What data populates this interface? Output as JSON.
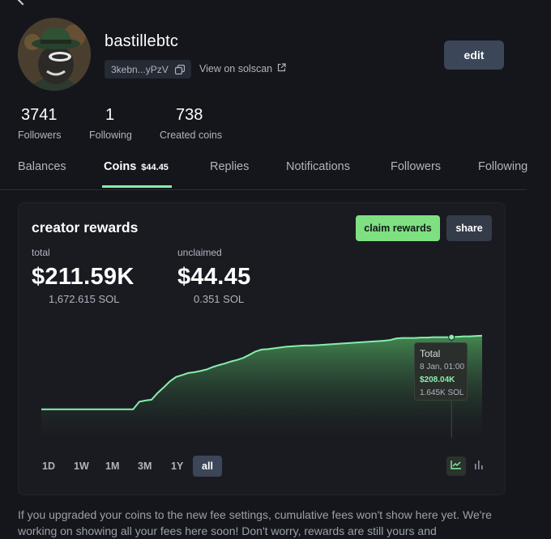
{
  "profile": {
    "username": "bastillebtc",
    "address_short": "3kebn...yPzV",
    "view_on_solscan": "View on solscan",
    "edit_label": "edit"
  },
  "stats": [
    {
      "value": "3741",
      "label": "Followers"
    },
    {
      "value": "1",
      "label": "Following"
    },
    {
      "value": "738",
      "label": "Created coins"
    }
  ],
  "tabs": [
    {
      "label": "Balances"
    },
    {
      "label": "Coins",
      "badge": "$44.45",
      "active": true
    },
    {
      "label": "Replies"
    },
    {
      "label": "Notifications"
    },
    {
      "label": "Followers"
    },
    {
      "label": "Following"
    }
  ],
  "rewards": {
    "title": "creator rewards",
    "claim_label": "claim rewards",
    "share_label": "share",
    "total": {
      "label": "total",
      "usd": "$211.59K",
      "sol": "1,672.615 SOL"
    },
    "unclaimed": {
      "label": "unclaimed",
      "usd": "$44.45",
      "sol": "0.351 SOL"
    },
    "tooltip": {
      "title": "Total",
      "date": "8 Jan, 01:00",
      "usd": "$208.04K",
      "sol": "1.645K SOL"
    },
    "ranges": [
      "1D",
      "1W",
      "1M",
      "3M",
      "1Y",
      "all"
    ],
    "active_range": "all",
    "accent_color": "#86efac"
  },
  "chart_data": {
    "type": "area",
    "series": [
      {
        "values": [
          27,
          27,
          27,
          27,
          27,
          27,
          27,
          27,
          27,
          27,
          27,
          27,
          27,
          27,
          27,
          27,
          46,
          49,
          51,
          68,
          82,
          97,
          108,
          113,
          118,
          120,
          123,
          127,
          133,
          138,
          142,
          147,
          151,
          156,
          164,
          172,
          177,
          178,
          180,
          182,
          184,
          185,
          186,
          187,
          187,
          188,
          189,
          190,
          191,
          192,
          193,
          194,
          195,
          196,
          197,
          198,
          199,
          201,
          205,
          206,
          206,
          206,
          207,
          207,
          208,
          208,
          208,
          208.04,
          209,
          210,
          210,
          211,
          211.59
        ]
      }
    ],
    "highlight_value": 208.04,
    "grid": false,
    "legend": "none"
  },
  "footnote": "If you upgraded your coins to the new fee settings, cumulative fees won't show here yet. We're working on showing all your fees here soon! Don't worry, rewards are still yours and"
}
